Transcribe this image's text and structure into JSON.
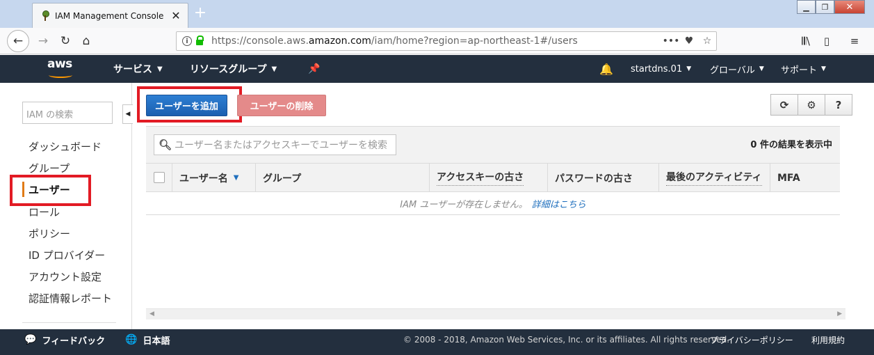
{
  "browser": {
    "tab_title": "IAM Management Console",
    "url_prefix": "https://console.aws.",
    "url_domain": "amazon.com",
    "url_suffix": "/iam/home?region=ap-northeast-1#/users"
  },
  "aws_header": {
    "logo": "aws",
    "services": "サービス",
    "resource_groups": "リソースグループ",
    "account": "startdns.01",
    "region": "グローバル",
    "support": "サポート"
  },
  "sidebar": {
    "search_placeholder": "IAM の検索",
    "items": [
      {
        "label": "ダッシュボード"
      },
      {
        "label": "グループ"
      },
      {
        "label": "ユーザー"
      },
      {
        "label": "ロール"
      },
      {
        "label": "ポリシー"
      },
      {
        "label": "ID プロバイダー"
      },
      {
        "label": "アカウント設定"
      },
      {
        "label": "認証情報レポート"
      }
    ],
    "active_index": 2
  },
  "main": {
    "add_user_label": "ユーザーを追加",
    "delete_user_label": "ユーザーの削除",
    "filter_placeholder": "ユーザー名またはアクセスキーでユーザーを検索",
    "result_count": "0 件の結果を表示中",
    "columns": [
      "ユーザー名",
      "グループ",
      "アクセスキーの古さ",
      "パスワードの古さ",
      "最後のアクティビティ",
      "MFA"
    ],
    "empty_message": "IAM ユーザーが存在しません。",
    "empty_link": "詳細はこちら"
  },
  "footer": {
    "feedback": "フィードバック",
    "language": "日本語",
    "copyright": "© 2008 - 2018, Amazon Web Services, Inc. or its affiliates. All rights reserved.",
    "privacy": "プライバシーポリシー",
    "terms": "利用規約"
  },
  "colors": {
    "aws_navy": "#232f3e",
    "aws_orange": "#ff9900",
    "primary_button": "#1f6fbd",
    "danger_button": "#e48a8a",
    "highlight": "#e21b24"
  }
}
